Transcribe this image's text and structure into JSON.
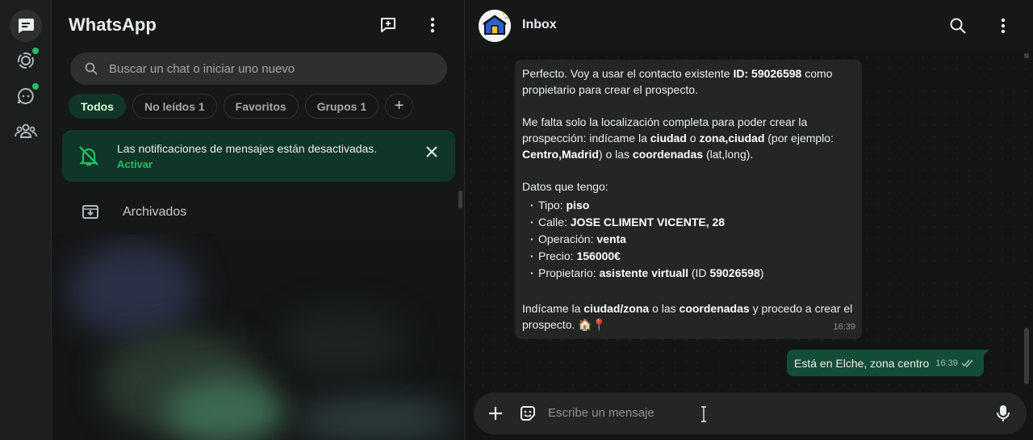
{
  "app": {
    "title": "WhatsApp"
  },
  "sidebar": {
    "rail": [
      {
        "name": "chats",
        "icon": "chats-icon",
        "active": true
      },
      {
        "name": "status",
        "icon": "status-icon",
        "badge": true
      },
      {
        "name": "channels",
        "icon": "channels-icon",
        "badge": true
      },
      {
        "name": "communities",
        "icon": "communities-icon"
      }
    ]
  },
  "chatlist": {
    "title": "WhatsApp",
    "search_placeholder": "Buscar un chat o iniciar uno nuevo",
    "filters": [
      "Todos",
      "No leídos 1",
      "Favoritos",
      "Grupos 1"
    ],
    "active_filter": "Todos",
    "notification": {
      "text": "Las notificaciones de mensajes están desactivadas.",
      "action": "Activar"
    },
    "archived_label": "Archivados"
  },
  "conversation": {
    "name": "Inbox",
    "incoming": {
      "intro": "Perfecto. Voy a usar el contacto existente",
      "intro_id": "ID: 59026598",
      "intro_tail": "como propietario para crear el prospecto.",
      "p2_a": "Me falta solo la localización completa para poder crear la prospección: indícame la",
      "p2_ciudad": "ciudad",
      "p2_o": "o",
      "p2_zona": "zona,ciudad",
      "p2_ej": "(por ejemplo:",
      "p2_ex": "Centro,Madrid",
      "p2_b": ") o las",
      "p2_coords": "coordenadas",
      "p2_c": "(lat,long).",
      "datos_title": "Datos que tengo:",
      "items": [
        {
          "label": "Tipo:",
          "value": "piso",
          "tail": ""
        },
        {
          "label": "Calle:",
          "value": "JOSE CLIMENT VICENTE, 28",
          "tail": ""
        },
        {
          "label": "Operación:",
          "value": "venta",
          "tail": ""
        },
        {
          "label": "Precio:",
          "value": "156000€",
          "tail": ""
        },
        {
          "label": "Propietario:",
          "value": "asistente virtuall",
          "tail": "(ID",
          "tail_id": "59026598",
          "tail_end": ")"
        }
      ],
      "p4_a": "Indícame la",
      "p4_cz": "ciudad/zona",
      "p4_b": "o las",
      "p4_coords": "coordenadas",
      "p4_c": "y procedo a crear el prospecto.",
      "p4_emoji": "🏠📍",
      "time": "16:39"
    },
    "outgoing": {
      "text": "Está en Elche, zona centro",
      "time": "16:39"
    },
    "composer_placeholder": "Escribe un mensaje"
  },
  "colors": {
    "accent": "#21c063",
    "chip_active_bg": "#103529",
    "outgoing_bubble": "#144d37",
    "incoming_bubble": "#242626"
  }
}
